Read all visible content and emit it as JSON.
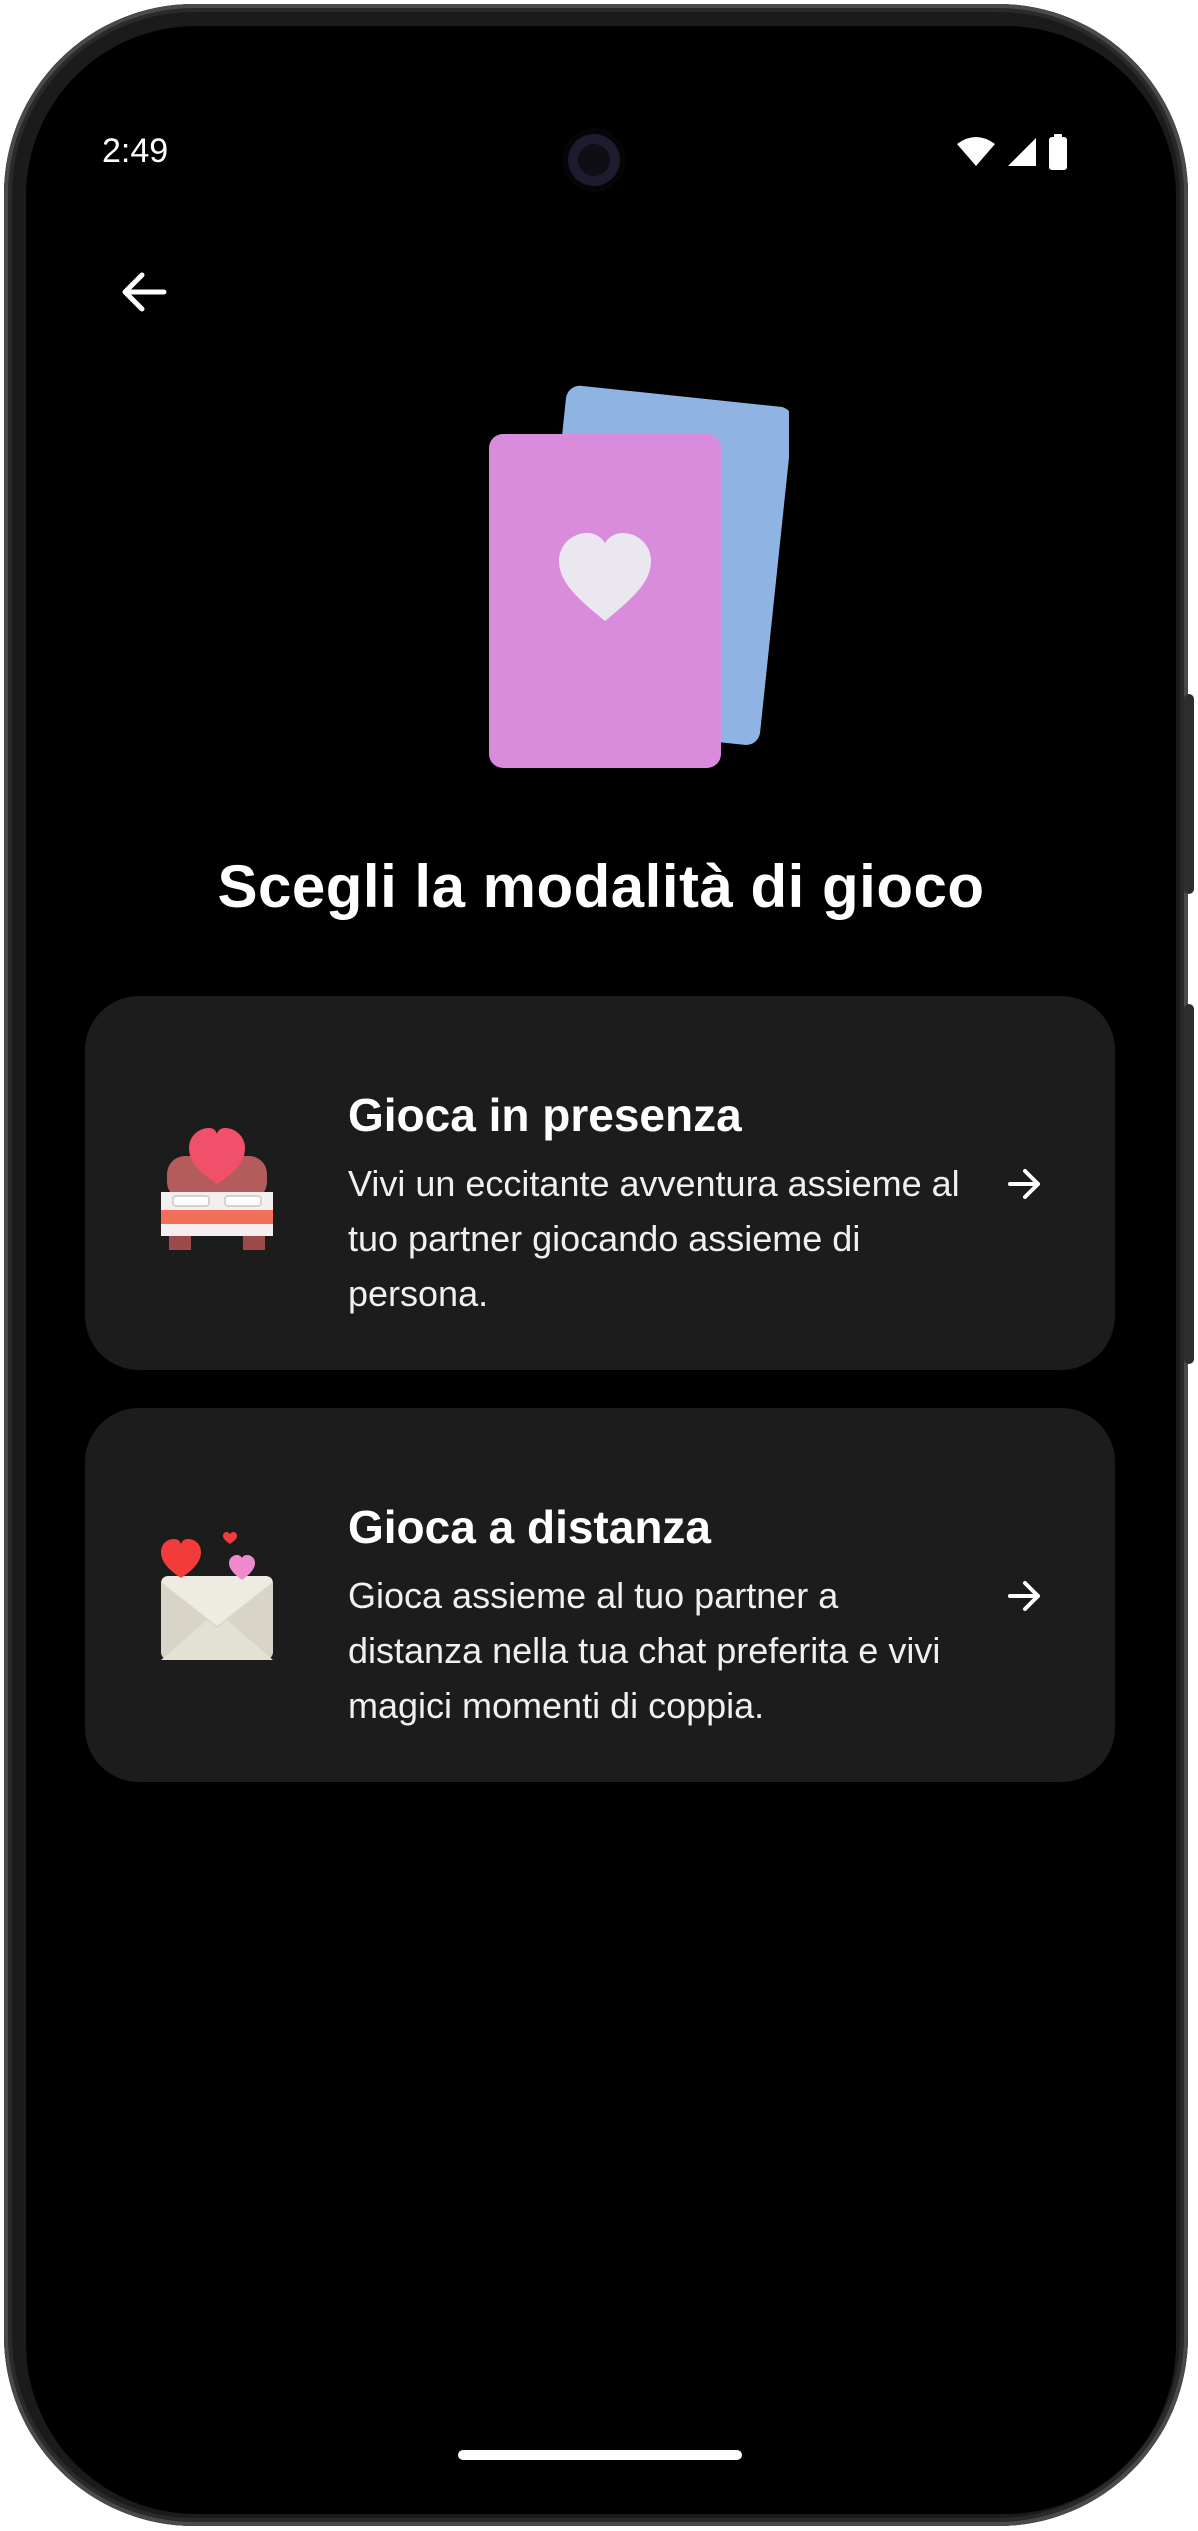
{
  "status_bar": {
    "time": "2:49",
    "icons": [
      "wifi-icon",
      "signal-icon",
      "battery-icon"
    ]
  },
  "nav": {
    "back_icon": "arrow-left-icon"
  },
  "hero": {
    "icon": "heart-cards-icon",
    "colors": {
      "front_card": "#D98BDC",
      "back_card": "#8FB4E3",
      "heart": "#EAE8EE"
    }
  },
  "title": "Scegli la modalità di gioco",
  "options": [
    {
      "title": "Gioca in presenza",
      "description": "Vivi un eccitante avventura assieme al tuo partner giocando assieme di persona.",
      "icon": "bed-heart-icon",
      "arrow_icon": "arrow-right-icon"
    },
    {
      "title": "Gioca a distanza",
      "description": "Gioca assieme al tuo partner a distanza nella tua chat preferita e vivi magici momenti di coppia.",
      "icon": "love-letter-icon",
      "arrow_icon": "arrow-right-icon"
    }
  ],
  "colors": {
    "background": "#000000",
    "card": "#1C1C1C",
    "text": "#FFFFFF"
  }
}
